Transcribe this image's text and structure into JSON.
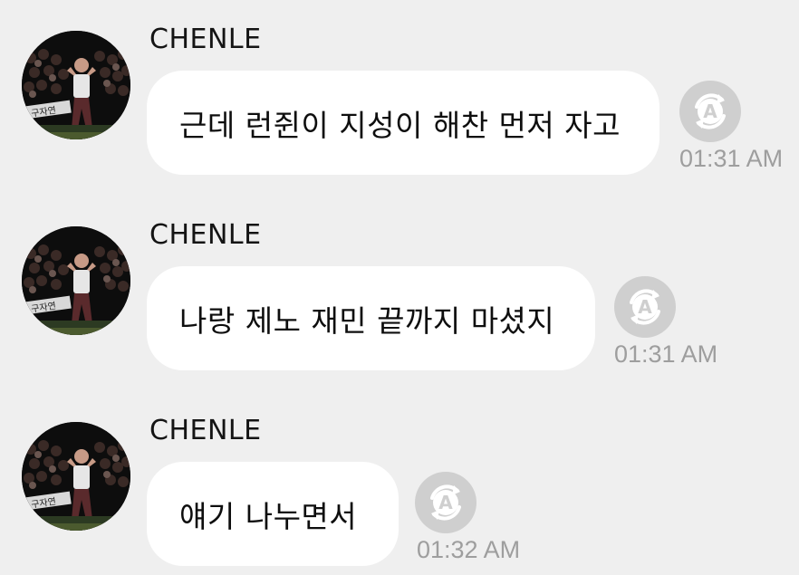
{
  "colors": {
    "background": "#efefef",
    "bubble": "#ffffff",
    "text": "#0e0e0e",
    "timestamp": "#9e9e9e",
    "icon": "#c8c8c8"
  },
  "messages": [
    {
      "sender": "CHENLE",
      "text": "근데 런쥔이 지성이 해찬 먼저 자고",
      "time": "01:31 AM",
      "icon": "auto-translate-icon"
    },
    {
      "sender": "CHENLE",
      "text": "나랑 제노 재민 끝까지 마셨지",
      "time": "01:31 AM",
      "icon": "auto-translate-icon"
    },
    {
      "sender": "CHENLE",
      "text": "얘기 나누면서",
      "time": "01:32 AM",
      "icon": "auto-translate-icon"
    }
  ]
}
